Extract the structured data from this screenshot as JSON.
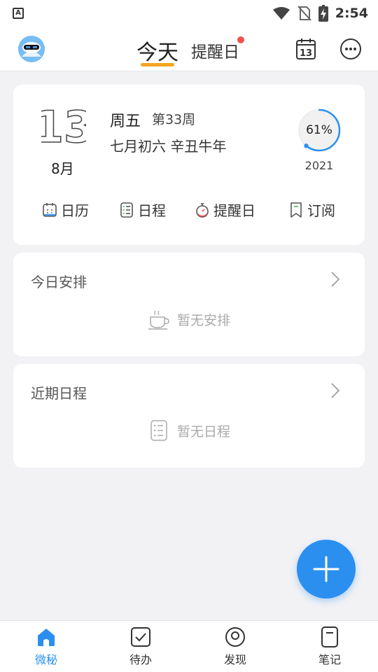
{
  "status_bar": {
    "left_icon": "A",
    "time": "2:54",
    "icons": [
      "wifi-icon",
      "no-sim-icon",
      "battery-charging-icon"
    ]
  },
  "header": {
    "tabs": [
      {
        "label": "今天",
        "active": true
      },
      {
        "label": "提醒日",
        "has_dot": true
      }
    ],
    "calendar_day": "13",
    "icons": [
      "avatar",
      "calendar-icon",
      "more-icon"
    ],
    "colors": {
      "accent_underline": "#f5a623",
      "dot": "#f0524c"
    }
  },
  "date_card": {
    "day": "13",
    "month": "8月",
    "weekday": "周五",
    "week_number": "第33周",
    "lunar": "七月初六  辛丑牛年",
    "year_progress_label": "61%",
    "year_progress": 0.61,
    "year": "2021",
    "quick_links": [
      {
        "label": "日历",
        "icon": "calendar-icon"
      },
      {
        "label": "日程",
        "icon": "list-icon"
      },
      {
        "label": "提醒日",
        "icon": "stopwatch-icon"
      },
      {
        "label": "订阅",
        "icon": "bookmark-icon"
      }
    ]
  },
  "today_plan": {
    "title": "今日安排",
    "empty_text": "暂无安排",
    "empty_icon": "coffee-cup-icon"
  },
  "recent_schedule": {
    "title": "近期日程",
    "empty_text": "暂无日程",
    "empty_icon": "list-icon"
  },
  "fab": {
    "icon": "plus-icon",
    "color": "#2b8ff0"
  },
  "bottom_nav": [
    {
      "label": "微秘",
      "icon": "home-icon",
      "active": true
    },
    {
      "label": "待办",
      "icon": "checkbox-icon"
    },
    {
      "label": "发现",
      "icon": "compass-icon"
    },
    {
      "label": "笔记",
      "icon": "note-icon"
    }
  ]
}
